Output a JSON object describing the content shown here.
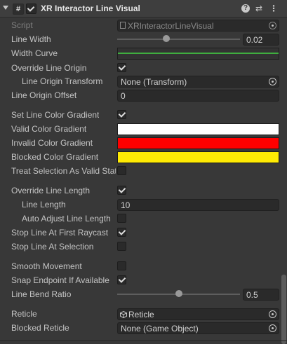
{
  "header": {
    "title": "XR Interactor Line Visual",
    "enabled": true,
    "script_glyph": "#",
    "icons": [
      "help-icon",
      "preset-icon",
      "context-menu-icon"
    ]
  },
  "fields": {
    "script": {
      "label": "Script",
      "value": "XRInteractorLineVisual"
    },
    "line_width": {
      "label": "Line Width",
      "value": "0.02",
      "slider_fraction": 0.4
    },
    "width_curve": {
      "label": "Width Curve"
    },
    "override_line_origin": {
      "label": "Override Line Origin",
      "checked": true
    },
    "line_origin_transform": {
      "label": "Line Origin Transform",
      "value": "None (Transform)"
    },
    "line_origin_offset": {
      "label": "Line Origin Offset",
      "value": "0"
    },
    "set_line_color_gradient": {
      "label": "Set Line Color Gradient",
      "checked": true
    },
    "valid_color_gradient": {
      "label": "Valid Color Gradient",
      "color": "#ffffff"
    },
    "invalid_color_gradient": {
      "label": "Invalid Color Gradient",
      "color": "#ff0000"
    },
    "blocked_color_gradient": {
      "label": "Blocked Color Gradient",
      "color": "#ffeb04"
    },
    "treat_selection_as_valid_state": {
      "label": "Treat Selection As Valid State",
      "checked": false
    },
    "override_line_length": {
      "label": "Override Line Length",
      "checked": true
    },
    "line_length": {
      "label": "Line Length",
      "value": "10"
    },
    "auto_adjust_line_length": {
      "label": "Auto Adjust Line Length",
      "checked": false
    },
    "stop_line_at_first_raycast": {
      "label": "Stop Line At First Raycast",
      "checked": true
    },
    "stop_line_at_selection": {
      "label": "Stop Line At Selection",
      "checked": false
    },
    "smooth_movement": {
      "label": "Smooth Movement",
      "checked": false
    },
    "snap_endpoint_if_available": {
      "label": "Snap Endpoint If Available",
      "checked": true
    },
    "line_bend_ratio": {
      "label": "Line Bend Ratio",
      "value": "0.5",
      "slider_fraction": 0.5
    },
    "reticle": {
      "label": "Reticle",
      "value": "Reticle"
    },
    "blocked_reticle": {
      "label": "Blocked Reticle",
      "value": "None (Game Object)"
    }
  },
  "colors": {
    "panel": "#383838",
    "curve_line": "#3fae3f"
  }
}
